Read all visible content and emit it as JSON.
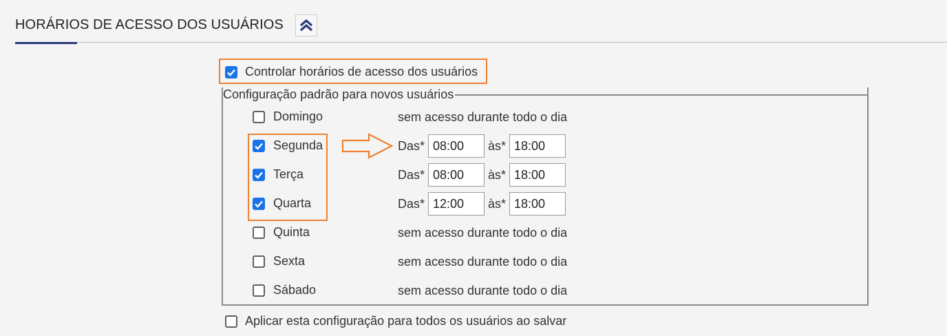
{
  "section": {
    "title": "HORÁRIOS DE ACESSO DOS USUÁRIOS",
    "collapse_icon": "chevron-double-up-icon"
  },
  "control": {
    "label": "Controlar horários de acesso dos usuários",
    "checked": true
  },
  "config": {
    "legend": "Configuração padrão para novos usuários",
    "days": [
      {
        "name": "Domingo",
        "checked": false,
        "no_access": "sem acesso durante todo o dia"
      },
      {
        "name": "Segunda",
        "checked": true,
        "from_label": "Das*",
        "from": "08:00",
        "to_label": "às*",
        "to": "18:00"
      },
      {
        "name": "Terça",
        "checked": true,
        "from_label": "Das*",
        "from": "08:00",
        "to_label": "às*",
        "to": "18:00"
      },
      {
        "name": "Quarta",
        "checked": true,
        "from_label": "Das*",
        "from": "12:00",
        "to_label": "às*",
        "to": "18:00"
      },
      {
        "name": "Quinta",
        "checked": false,
        "no_access": "sem acesso durante todo o dia"
      },
      {
        "name": "Sexta",
        "checked": false,
        "no_access": "sem acesso durante todo o dia"
      },
      {
        "name": "Sábado",
        "checked": false,
        "no_access": "sem acesso durante todo o dia"
      }
    ]
  },
  "apply_all": {
    "label": "Aplicar esta configuração para todos os usuários ao salvar",
    "checked": false
  },
  "colors": {
    "accent": "#2b3a7a",
    "highlight": "#f08030",
    "checkbox": "#1a73e8"
  }
}
